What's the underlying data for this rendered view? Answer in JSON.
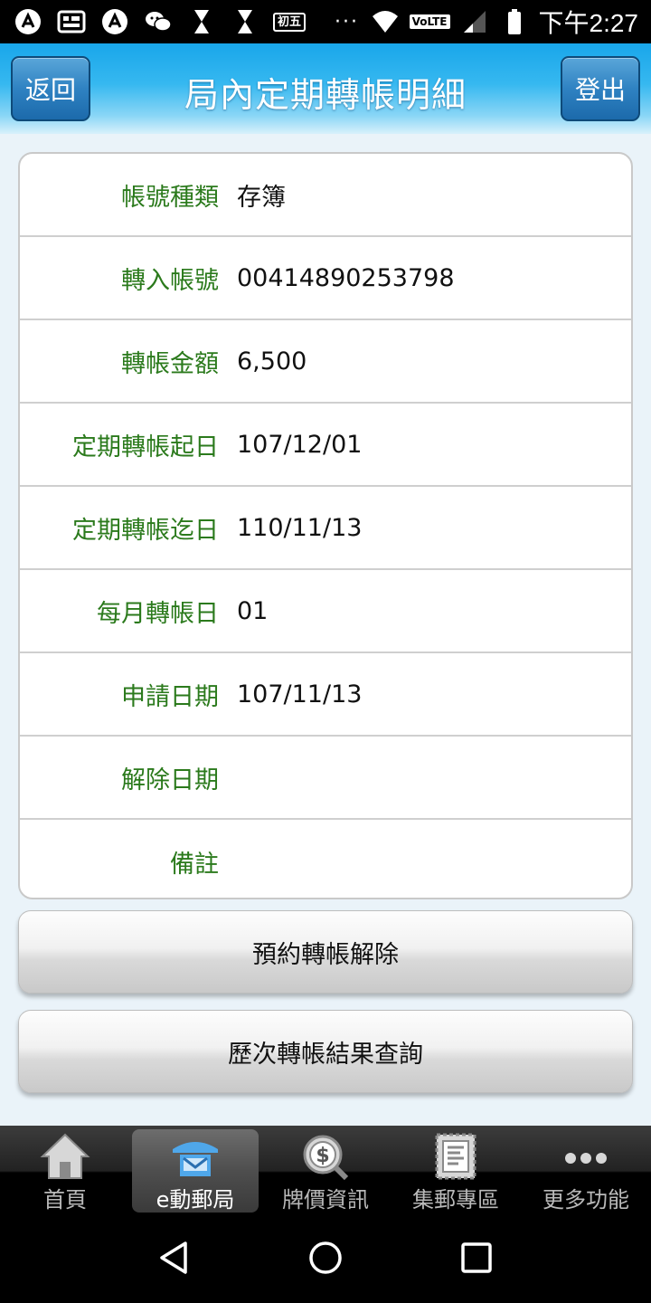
{
  "status_bar": {
    "date_badge": "初五",
    "network": "VoLTE",
    "time": "下午2:27"
  },
  "header": {
    "title": "局內定期轉帳明細",
    "back_label": "返回",
    "logout_label": "登出"
  },
  "details": [
    {
      "label": "帳號種類",
      "value": "存簿"
    },
    {
      "label": "轉入帳號",
      "value": "00414890253798"
    },
    {
      "label": "轉帳金額",
      "value": "6,500"
    },
    {
      "label": "定期轉帳起日",
      "value": "107/12/01"
    },
    {
      "label": "定期轉帳迄日",
      "value": "110/11/13"
    },
    {
      "label": "每月轉帳日",
      "value": "01"
    },
    {
      "label": "申請日期",
      "value": "107/11/13"
    },
    {
      "label": "解除日期",
      "value": ""
    },
    {
      "label": "備註",
      "value": ""
    }
  ],
  "actions": {
    "cancel_label": "預約轉帳解除",
    "history_label": "歷次轉帳結果查詢"
  },
  "bottom_nav": [
    {
      "label": "首頁",
      "icon": "home-icon",
      "active": false
    },
    {
      "label": "e動郵局",
      "icon": "e-post-icon",
      "active": true
    },
    {
      "label": "牌價資訊",
      "icon": "dollar-search-icon",
      "active": false
    },
    {
      "label": "集郵專區",
      "icon": "stamp-icon",
      "active": false
    },
    {
      "label": "更多功能",
      "icon": "more-icon",
      "active": false
    }
  ],
  "colors": {
    "label_green": "#2b7a1c",
    "header_blue": "#19a6ea",
    "button_blue": "#2f82c2"
  }
}
